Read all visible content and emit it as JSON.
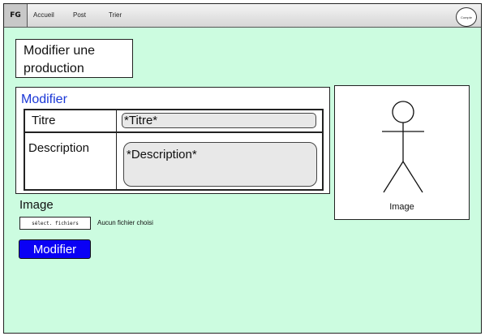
{
  "navbar": {
    "logo": "FG",
    "links": [
      "Accueil",
      "Post",
      "Trier"
    ],
    "account": "Compte"
  },
  "page": {
    "title": "Modifier une production"
  },
  "form": {
    "heading": "Modifier",
    "title_label": "Titre",
    "title_placeholder": "*Titre*",
    "description_label": "Description",
    "description_placeholder": "*Description*"
  },
  "preview": {
    "icon": "person-icon",
    "caption": "Image"
  },
  "upload": {
    "label": "Image",
    "button_label": "sélect. fichiers",
    "status": "Aucun fichier choisi"
  },
  "submit": {
    "label": "Modifier"
  },
  "colors": {
    "background": "#ccfce0",
    "heading": "#1a37d6",
    "button": "#0a00f5"
  }
}
